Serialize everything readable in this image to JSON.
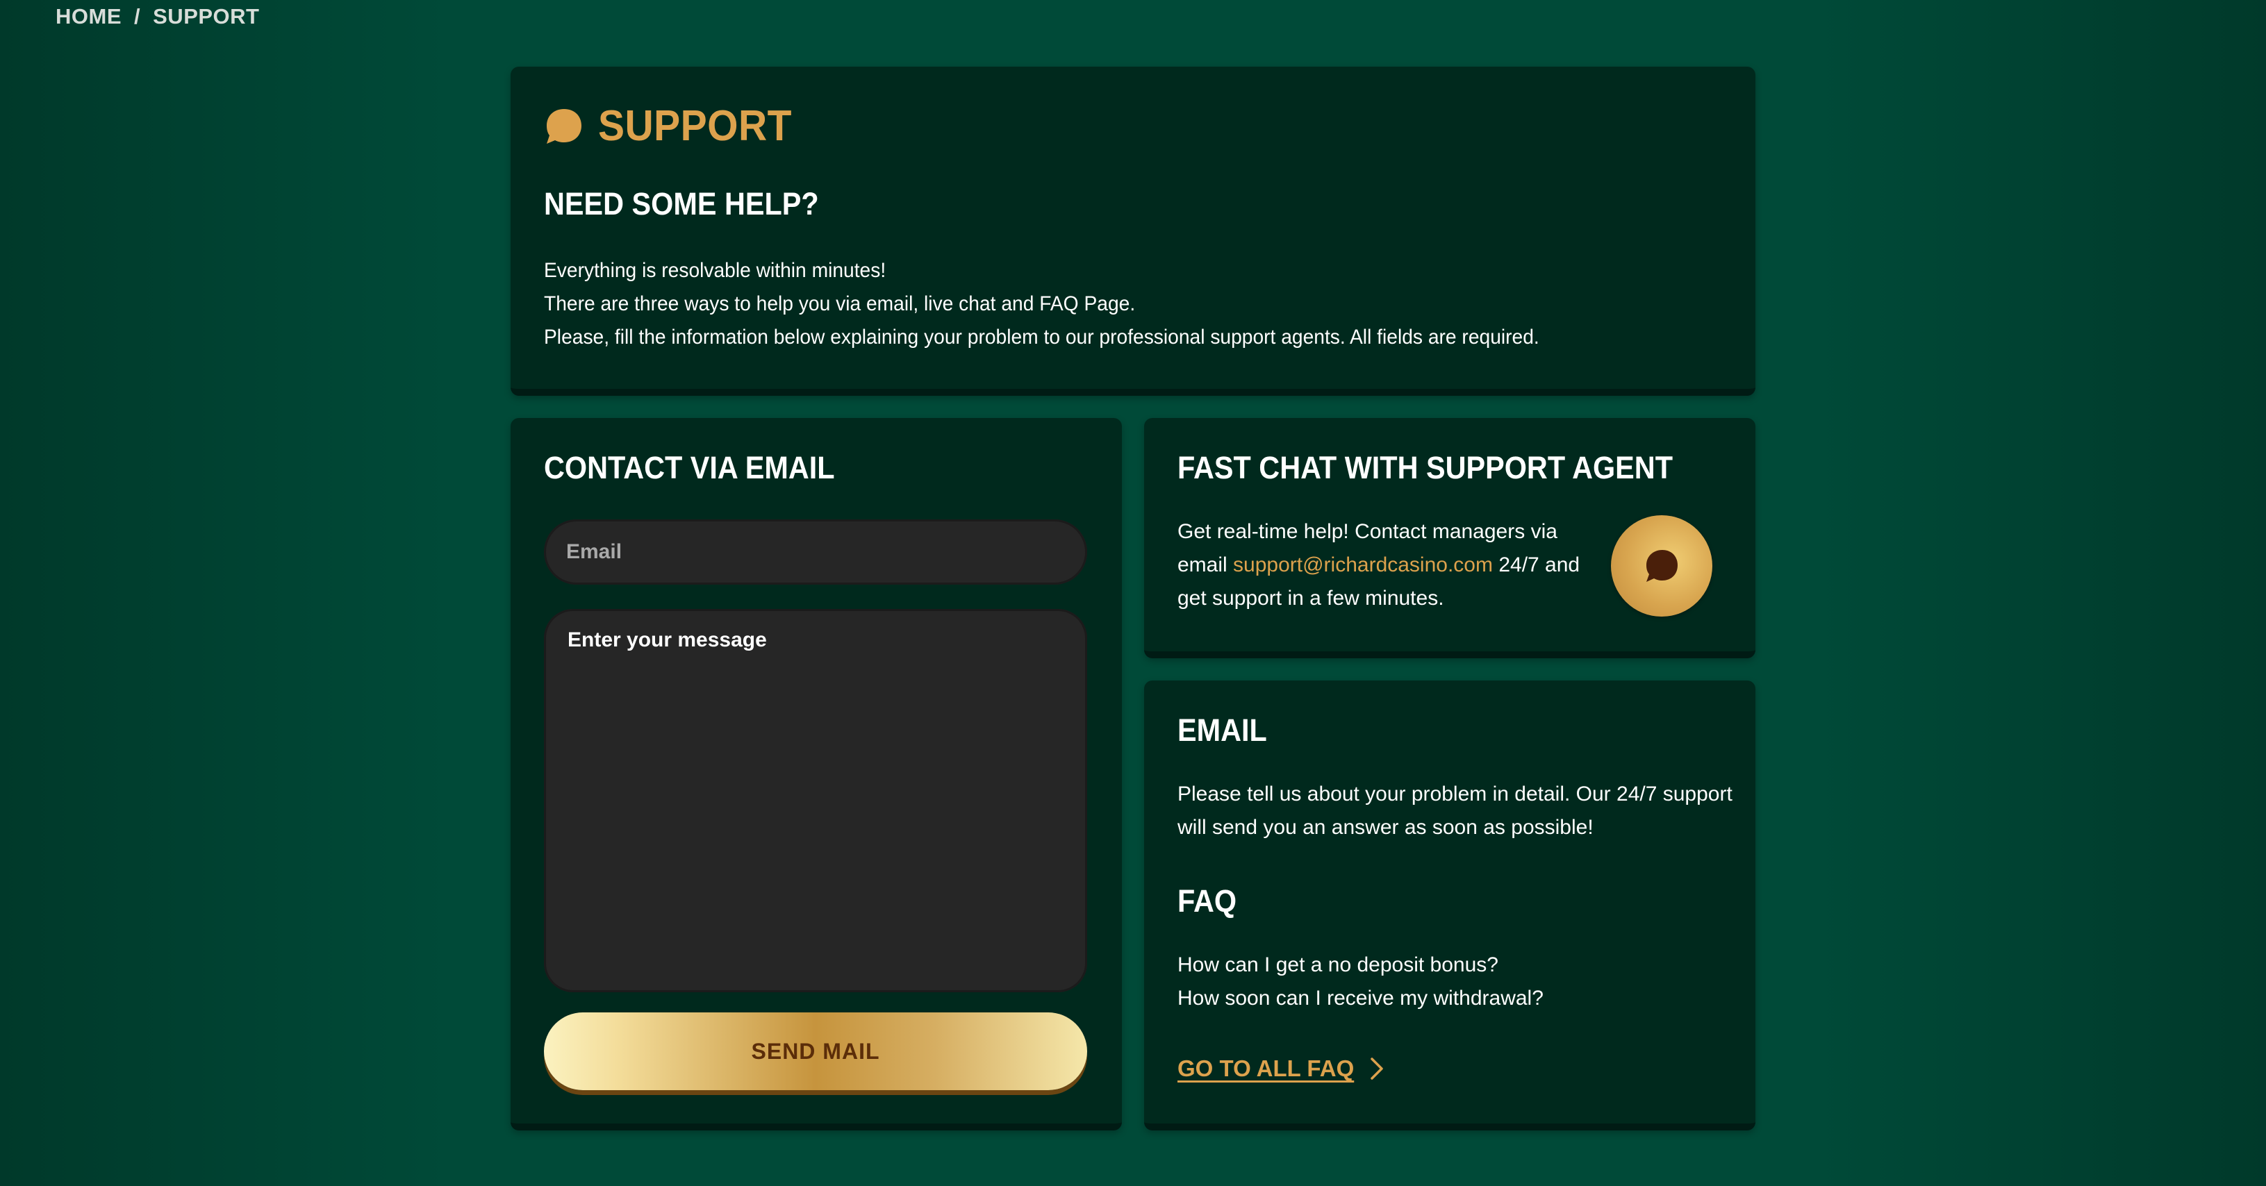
{
  "breadcrumb": {
    "home": "HOME",
    "separator": "/",
    "current": "SUPPORT"
  },
  "support": {
    "title": "SUPPORT",
    "icon": "chat-bubble-icon",
    "heading": "NEED SOME HELP?",
    "lines": [
      "Everything is resolvable within minutes!",
      "There are three ways to help you via email, live chat and FAQ Page.",
      "Please, fill the information below explaining your problem to our professional support agents. All fields are required."
    ]
  },
  "contact": {
    "heading": "CONTACT VIA EMAIL",
    "email_placeholder": "Email",
    "message_placeholder": "Enter your message",
    "send_label": "SEND MAIL"
  },
  "chat": {
    "heading": "FAST CHAT WITH SUPPORT AGENT",
    "text_before": "Get real-time help! Contact managers via email ",
    "email": "support@richardcasino.com",
    "text_after": " 24/7 and get support in a few minutes.",
    "icon": "chat-bubble-icon"
  },
  "email_section": {
    "heading": "EMAIL",
    "text": "Please tell us about your problem in detail. Our 24/7 support will send you an answer as soon as possible!"
  },
  "faq": {
    "heading": "FAQ",
    "questions": [
      "How can I get a no deposit bonus?",
      "How soon can I receive my withdrawal?"
    ],
    "all_link": "GO TO ALL FAQ"
  },
  "colors": {
    "accent_gold": "#dda24d",
    "panel_bg": "#00291d",
    "page_bg": "#004a38"
  }
}
